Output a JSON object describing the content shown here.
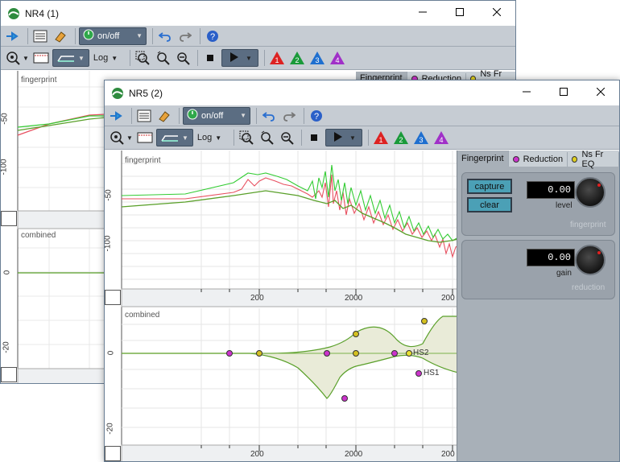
{
  "windows": {
    "back": {
      "title": "NR4 (1)",
      "toolbar": {
        "onoff_label": "on/off",
        "log_label": "Log"
      },
      "fingerprint_plot": {
        "title": "fingerprint",
        "y_ticks": [
          "-50",
          "-100"
        ]
      },
      "combined_plot": {
        "title": "combined",
        "y_ticks": [
          "0",
          "-20"
        ]
      },
      "tabs": [
        "Fingerprint",
        "Reduction",
        "Ns Fr EQ"
      ]
    },
    "front": {
      "title": "NR5 (2)",
      "toolbar": {
        "onoff_label": "on/off",
        "log_label": "Log"
      },
      "fingerprint_plot": {
        "title": "fingerprint",
        "y_ticks": [
          "-50",
          "-100"
        ],
        "x_ticks": [
          "200",
          "2000",
          "200"
        ]
      },
      "combined_plot": {
        "title": "combined",
        "y_ticks": [
          "0",
          "-20"
        ],
        "x_ticks": [
          "200",
          "2000",
          "200"
        ],
        "labels": [
          "HS2",
          "HS1"
        ]
      },
      "tabs": [
        {
          "label": "Fingerprint",
          "dot": ""
        },
        {
          "label": "Reduction",
          "dot": "#cc33cc"
        },
        {
          "label": "Ns Fr EQ",
          "dot": "#e0d020"
        }
      ],
      "fingerprint_group": {
        "capture_label": "capture",
        "clear_label": "clear",
        "level_value": "0.00",
        "level_label": "level",
        "group_name": "fingerprint"
      },
      "reduction_group": {
        "gain_value": "0.00",
        "gain_label": "gain",
        "group_name": "reduction"
      }
    }
  },
  "colors": {
    "curve_green": "#33cc33",
    "curve_red": "#e85060",
    "band_green": "#5aa02a",
    "toolbar_bg": "#c6ccd3",
    "panel_bg": "#a8b0b8",
    "accent_button": "#4ba0b6"
  },
  "icons": [
    "app-logo-icon",
    "pin-icon",
    "settings-icon",
    "eraser-icon",
    "power-icon",
    "undo-icon",
    "redo-icon",
    "help-icon",
    "zoom-target-icon",
    "display-icon",
    "graph-mode-icon",
    "zoom-icon",
    "zoom-reset-icon",
    "zoom-out-icon",
    "stop-icon",
    "play-icon",
    "marker-1-icon",
    "marker-2-icon",
    "marker-3-icon",
    "marker-4-icon",
    "minimize-icon",
    "maximize-icon",
    "close-icon"
  ],
  "markers": [
    "1",
    "2",
    "3",
    "4"
  ]
}
